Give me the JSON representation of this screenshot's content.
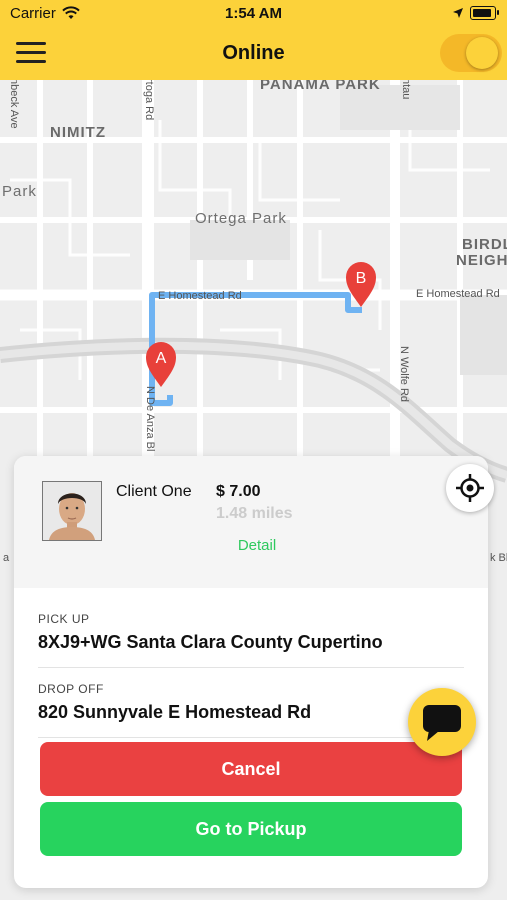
{
  "status_bar": {
    "carrier": "Carrier",
    "time": "1:54 AM"
  },
  "nav": {
    "title": "Online",
    "status_toggle_on": true
  },
  "map": {
    "labels": {
      "panama_park": "PANAMA PARK",
      "nimitz": "NIMITZ",
      "park": "Park",
      "ortega_park": "Ortega Park",
      "birdland_1": "BIRDL",
      "birdland_2": "NEIGH",
      "e_homestead_1": "E Homestead Rd",
      "e_homestead_2": "E Homestead Rd",
      "n_wolfe": "N Wolfe Rd",
      "n_de_anza": "N De Anza Bl",
      "tantau": "ntau",
      "ortega_rd": "rtoga Rd",
      "finch": "nbeck Ave",
      "right_bl": "k Bl",
      "left_a": "a"
    },
    "markers": {
      "origin": "A",
      "destination": "B"
    }
  },
  "trip": {
    "client_name": "Client One",
    "price": "$ 7.00",
    "distance": "1.48 miles",
    "detail_link": "Detail",
    "pickup_label": "PICK UP",
    "pickup_address": "8XJ9+WG Santa Clara County Cupertino",
    "dropoff_label": "DROP OFF",
    "dropoff_address": "820 Sunnyvale E Homestead Rd"
  },
  "actions": {
    "cancel": "Cancel",
    "go_to_pickup": "Go to Pickup"
  },
  "icons": {
    "menu": "hamburger-menu-icon",
    "locate": "crosshair-locate-icon",
    "chat": "chat-bubble-icon",
    "wifi": "wifi-icon",
    "location": "location-arrow-icon",
    "battery": "battery-icon"
  },
  "colors": {
    "brand_yellow": "#fcd23a",
    "cancel_red": "#ea4141",
    "go_green": "#27d35e",
    "detail_green": "#2ec95e",
    "route_blue": "#6fb3f2",
    "marker_red": "#e8403a"
  }
}
